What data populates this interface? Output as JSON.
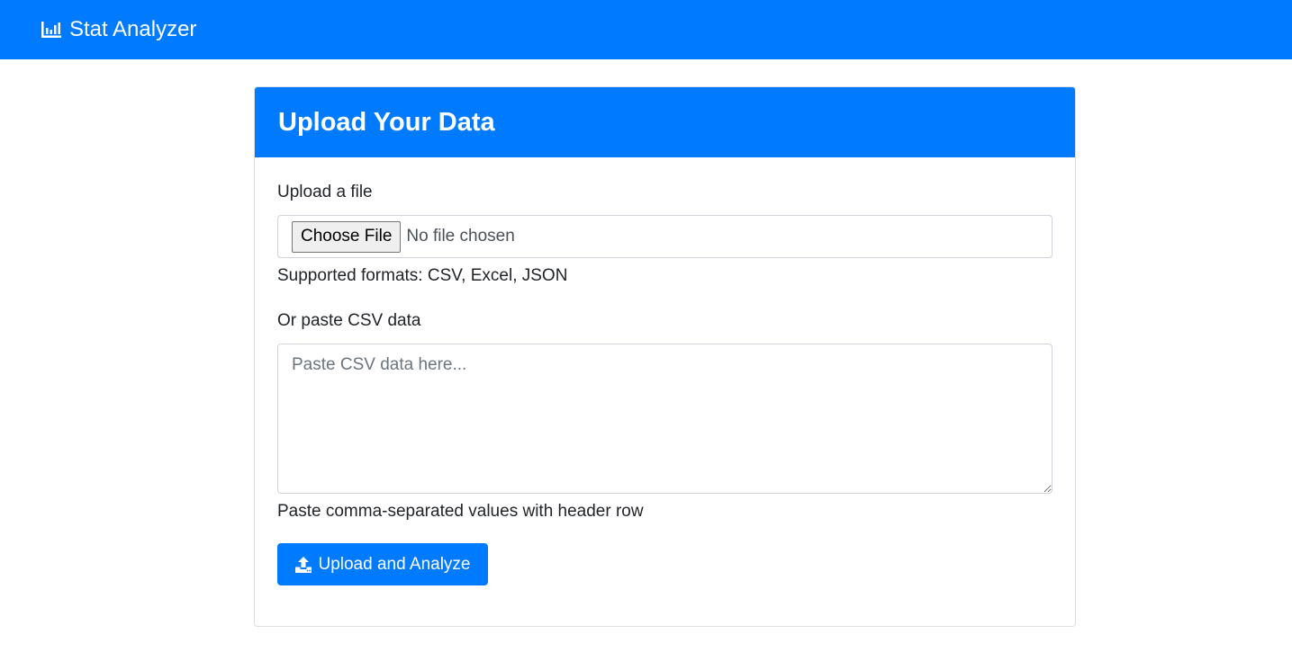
{
  "navbar": {
    "brand_icon": "bar-chart-icon",
    "brand_label": "Stat Analyzer",
    "accent_color": "#007bff"
  },
  "card": {
    "title": "Upload Your Data",
    "file_section": {
      "label": "Upload a file",
      "choose_button_label": "Choose File",
      "file_status": "No file chosen",
      "help_text": "Supported formats: CSV, Excel, JSON"
    },
    "csv_section": {
      "label": "Or paste CSV data",
      "value": "",
      "placeholder": "Paste CSV data here...",
      "help_text": "Paste comma-separated values with header row"
    },
    "submit": {
      "icon": "upload-icon",
      "label": "Upload and Analyze"
    }
  }
}
